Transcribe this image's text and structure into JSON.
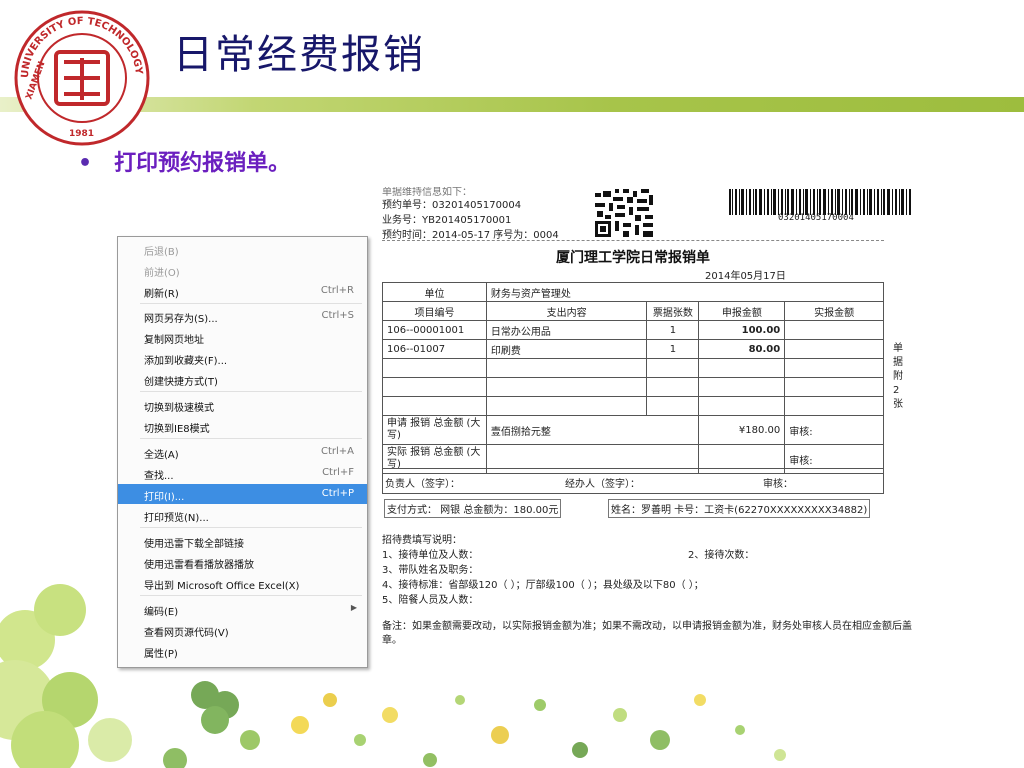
{
  "slide": {
    "title": "日常经费报销",
    "bullet": "打印预约报销单。",
    "logo": {
      "ring_top": "UNIVERSITY OF TECHNOLOGY",
      "ring_left": "XIAMEN",
      "year": "1981",
      "colors": {
        "ring": "#c0282b"
      }
    }
  },
  "screenshot": {
    "header": {
      "line0": "单据维持信息如下：",
      "reservation_no": "预约单号：03201405170004",
      "business_no": "业务号：YB201405170001",
      "reservation_time": "预约时间：2014-05-17 序号为：0004",
      "barcode_number": "03201405170004"
    },
    "context_menu": {
      "items": [
        {
          "label": "后退(B)",
          "shortcut": "",
          "disabled": true
        },
        {
          "label": "前进(O)",
          "shortcut": "",
          "disabled": true
        },
        {
          "label": "刷新(R)",
          "shortcut": "Ctrl+R"
        },
        {
          "label": "网页另存为(S)...",
          "shortcut": "Ctrl+S"
        },
        {
          "label": "复制网页地址",
          "shortcut": ""
        },
        {
          "label": "添加到收藏夹(F)...",
          "shortcut": ""
        },
        {
          "label": "创建快捷方式(T)",
          "shortcut": ""
        },
        {
          "label": "切换到极速模式",
          "shortcut": ""
        },
        {
          "label": "切换到IE8模式",
          "shortcut": ""
        },
        {
          "label": "全选(A)",
          "shortcut": "Ctrl+A"
        },
        {
          "label": "查找...",
          "shortcut": "Ctrl+F"
        },
        {
          "label": "打印(I)...",
          "shortcut": "Ctrl+P",
          "highlighted": true
        },
        {
          "label": "打印预览(N)...",
          "shortcut": ""
        },
        {
          "label": "使用迅雷下载全部链接",
          "shortcut": ""
        },
        {
          "label": "使用迅雷看看播放器播放",
          "shortcut": ""
        },
        {
          "label": "导出到 Microsoft Office Excel(X)",
          "shortcut": ""
        },
        {
          "label": "编码(E)",
          "shortcut": "",
          "submenu": true
        },
        {
          "label": "查看网页源代码(V)",
          "shortcut": ""
        },
        {
          "label": "属性(P)",
          "shortcut": ""
        }
      ]
    },
    "form": {
      "title": "厦门理工学院日常报销单",
      "date": "2014年05月17日",
      "unit_label": "单位",
      "unit_value": "财务与资产管理处",
      "columns": [
        "项目编号",
        "支出内容",
        "票据张数",
        "申报金额",
        "实报金额"
      ],
      "rows": [
        {
          "code": "106--00001001",
          "content": "日常办公用品",
          "count": "1",
          "amount": "100.00"
        },
        {
          "code": "106--01007",
          "content": "印刷费",
          "count": "1",
          "amount": "80.00"
        }
      ],
      "apply_total_label": "申请 报销 总金额 (大写)",
      "apply_total_cn": "壹佰捌拾元整",
      "apply_total_num": "¥180.00",
      "audit_label": "审核:",
      "actual_total_label": "实际 报销 总金额 (大写)",
      "actual_audit_label": "审核:",
      "signer_row": "负责人（签字）：",
      "handler": "经办人（签字）：",
      "reviewer": "审核：",
      "payment": "支付方式：  网银  总金额为：180.00元",
      "payee": "姓名：罗善明  卡号：工资卡(62270XXXXXXXXX34882)",
      "side_note": [
        "单",
        "据",
        "附",
        "2",
        "张"
      ]
    },
    "hospitality": {
      "heading": "招待费填写说明：",
      "item1": "1、接待单位及人数：",
      "item2": "2、接待次数：",
      "item3": "3、带队姓名及职务：",
      "item4": "4、接待标准：省部级120（ ）；厅部级100（ ）；县处级及以下80（ ）；",
      "item5": "5、陪餐人员及人数：",
      "remark": "备注：如果金额需要改动，以实际报销金额为准；如果不需改动，以申请报销金额为准，财务处审核人员在相应金额后盖章。"
    }
  }
}
